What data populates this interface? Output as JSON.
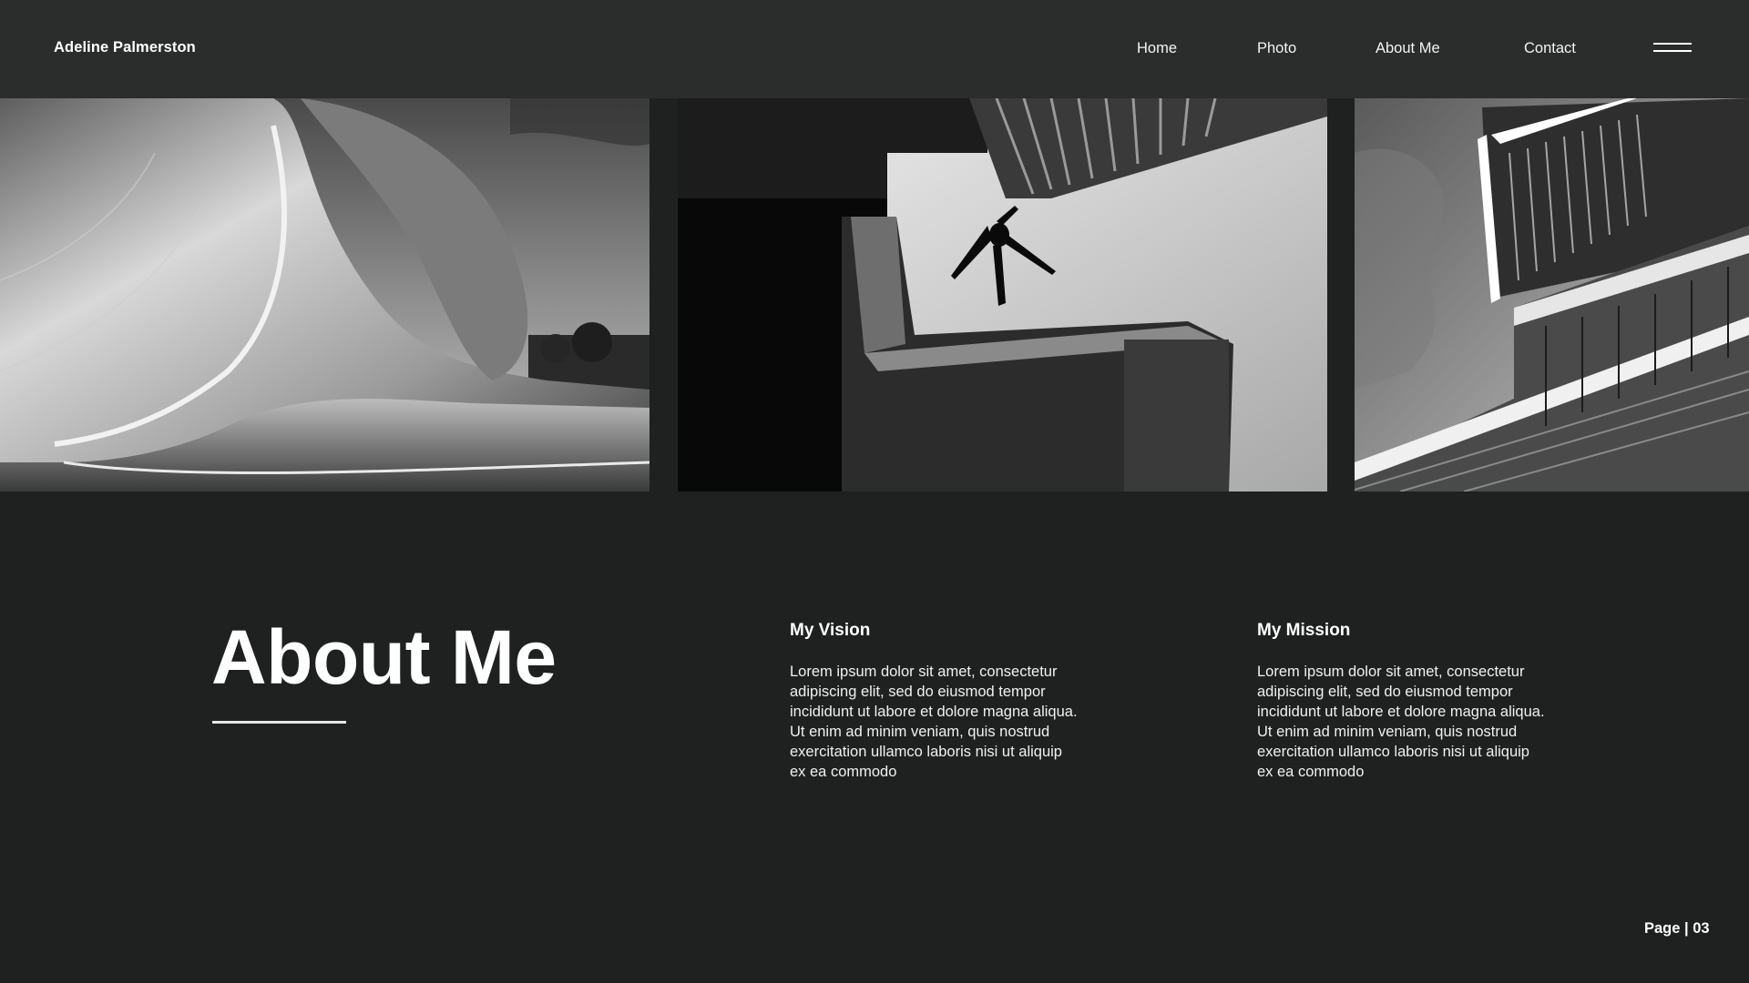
{
  "header": {
    "brand": "Adeline Palmerston",
    "nav": {
      "home": "Home",
      "photo": "Photo",
      "about": "About Me",
      "contact": "Contact"
    },
    "menu_icon": "hamburger-icon"
  },
  "gallery": [
    {
      "subject": "curved-architecture"
    },
    {
      "subject": "parkour-jump"
    },
    {
      "subject": "modern-building"
    }
  ],
  "about": {
    "title": "About Me",
    "vision": {
      "heading": "My Vision",
      "body": "Lorem ipsum dolor sit amet, consectetur adipiscing elit, sed do eiusmod tempor incididunt ut labore et dolore magna aliqua. Ut enim ad minim veniam, quis nostrud exercitation ullamco laboris nisi ut aliquip ex ea commodo"
    },
    "mission": {
      "heading": "My Mission",
      "body": "Lorem ipsum dolor sit amet, consectetur adipiscing elit, sed do eiusmod tempor incididunt ut labore et dolore magna aliqua. Ut enim ad minim veniam, quis nostrud exercitation ullamco laboris nisi ut aliquip ex ea commodo"
    }
  },
  "footer": {
    "page_label": "Page | 03"
  },
  "colors": {
    "background": "#1f2020",
    "header": "#2b2c2c",
    "text": "#ffffff"
  }
}
